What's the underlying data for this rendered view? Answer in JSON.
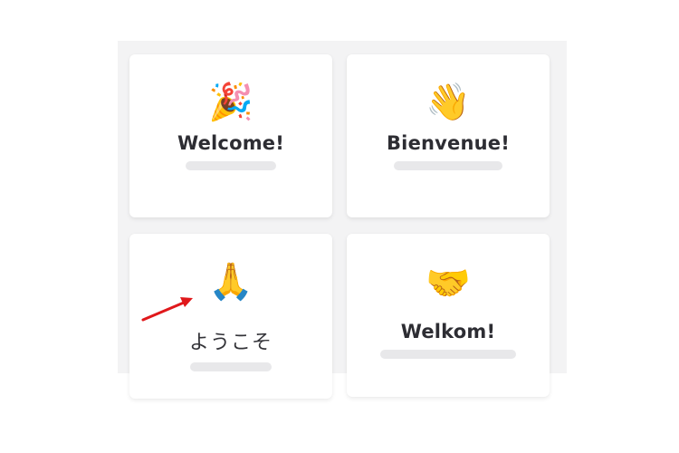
{
  "cards": [
    {
      "emoji": "🎉",
      "icon": "party-popper-icon",
      "title": "Welcome!"
    },
    {
      "emoji": "👋",
      "icon": "waving-hand-icon",
      "title": "Bienvenue!"
    },
    {
      "emoji": "🙏",
      "icon": "folded-hands-icon",
      "title": "ようこそ"
    },
    {
      "emoji": "🤝",
      "icon": "handshake-icon",
      "title": "Welkom!"
    }
  ],
  "annotation": {
    "arrow_color": "#e0181b",
    "points_to": "folded-hands-icon"
  },
  "colors": {
    "panel_bg": "#f3f3f4",
    "card_bg": "#ffffff",
    "title_text": "#2d2d33",
    "placeholder": "#e8e8ea"
  }
}
